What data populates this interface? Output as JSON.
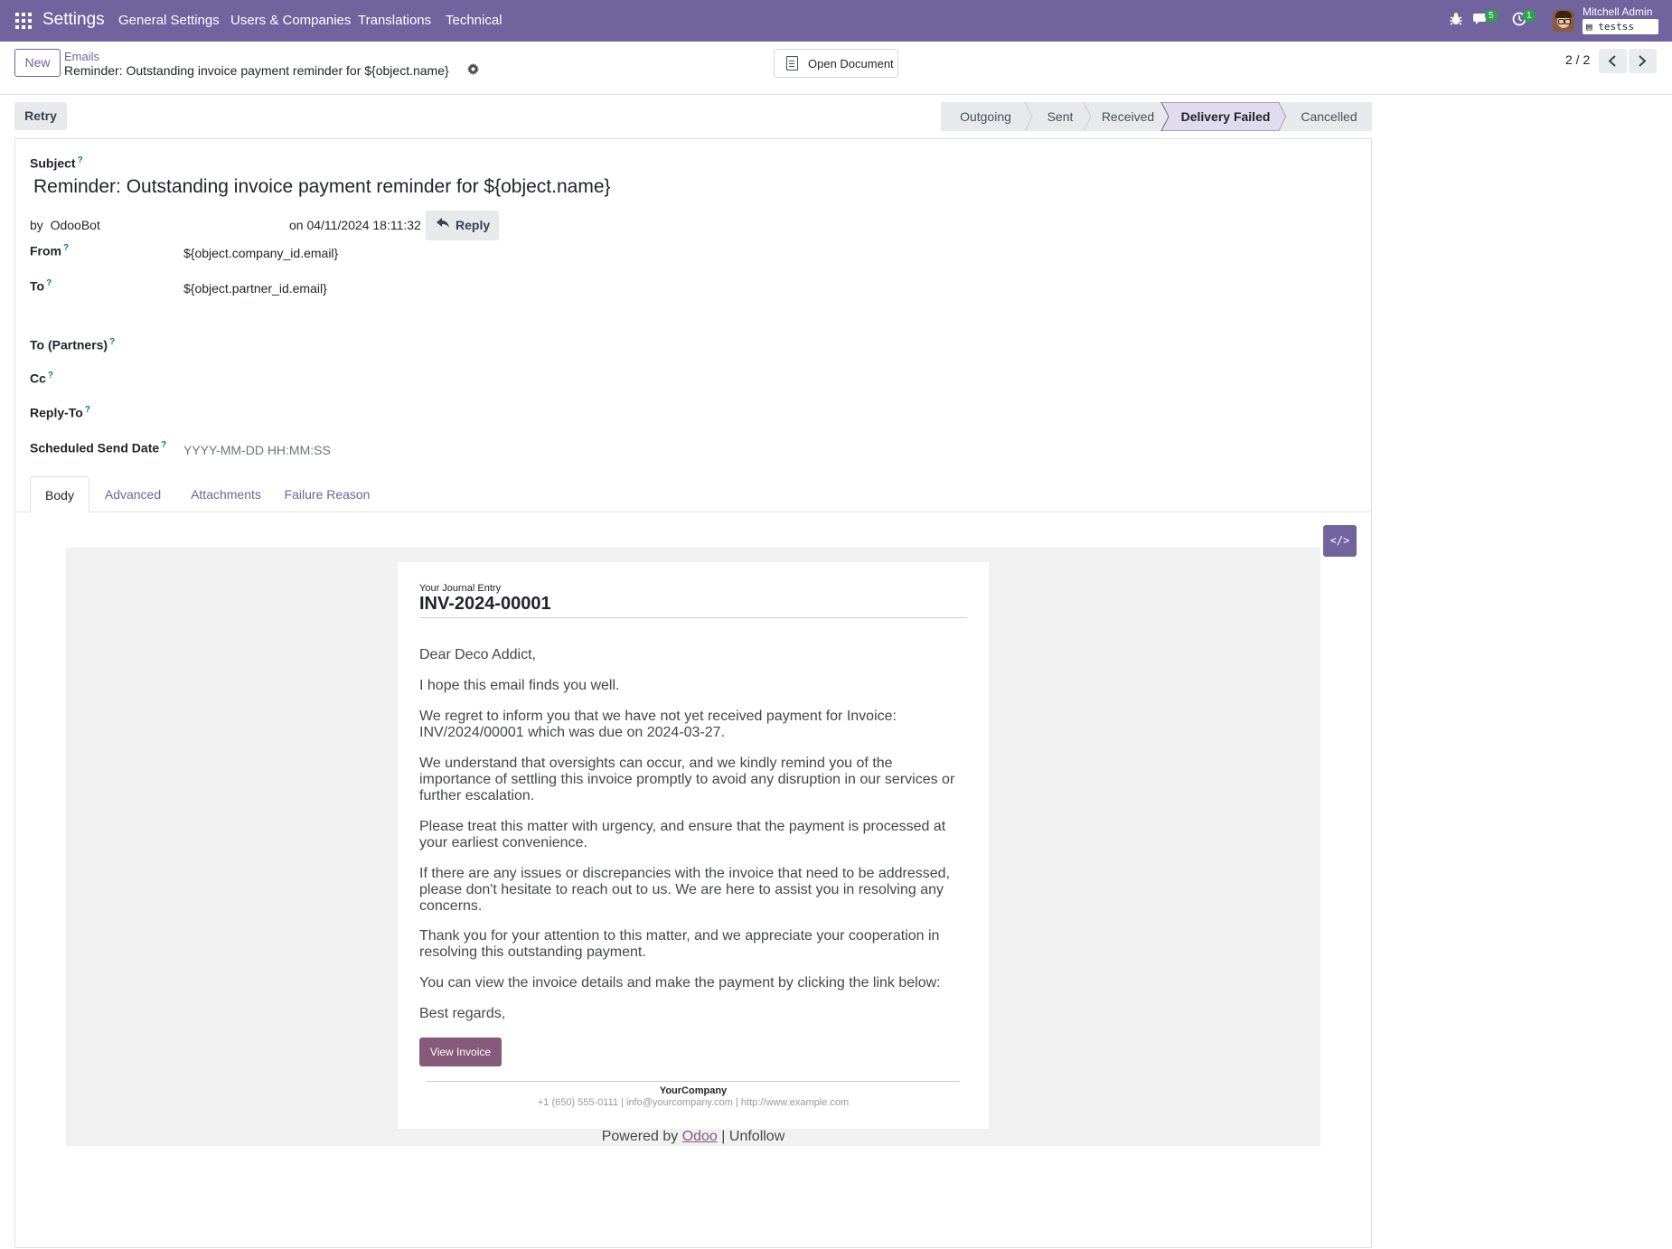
{
  "navbar": {
    "brand": "Settings",
    "menu": [
      "General Settings",
      "Users & Companies",
      "Translations",
      "Technical"
    ],
    "messages_count": "5",
    "activities_count": "1",
    "user_name": "Mitchell Admin",
    "database": "testss"
  },
  "control": {
    "new_label": "New",
    "breadcrumb_parent": "Emails",
    "breadcrumb_current": "Reminder: Outstanding invoice payment reminder for ${object.name}",
    "open_document_label": "Open Document",
    "pager": "2 / 2"
  },
  "statusbar": {
    "retry_label": "Retry",
    "stages": [
      "Outgoing",
      "Sent",
      "Received",
      "Delivery Failed",
      "Cancelled"
    ],
    "active_stage": "Delivery Failed"
  },
  "form": {
    "subject_label": "Subject",
    "subject_value": "Reminder: Outstanding invoice payment reminder for ${object.name}",
    "by_prefix": "by",
    "author": "OdooBot",
    "date_text": "on 04/11/2024 18:11:32",
    "reply_label": "Reply",
    "from_label": "From",
    "from_value": "${object.company_id.email}",
    "to_label": "To",
    "to_value": "${object.partner_id.email}",
    "to_partners_label": "To (Partners)",
    "cc_label": "Cc",
    "reply_to_label": "Reply-To",
    "scheduled_label": "Scheduled Send Date",
    "scheduled_placeholder": "YYYY-MM-DD HH:MM:SS",
    "help_mark": "?"
  },
  "tabs": [
    "Body",
    "Advanced",
    "Attachments",
    "Failure Reason"
  ],
  "active_tab": "Body",
  "email": {
    "header_small": "Your Journal Entry",
    "reference": "INV-2024-00001",
    "paragraphs": [
      "Dear Deco Addict,",
      "I hope this email finds you well.",
      "We regret to inform you that we have not yet received payment for Invoice: INV/2024/00001 which was due on 2024-03-27.",
      "We understand that oversights can occur, and we kindly remind you of the importance of settling this invoice promptly to avoid any disruption in our services or further escalation.",
      "Please treat this matter with urgency, and ensure that the payment is processed at your earliest convenience.",
      "If there are any issues or discrepancies with the invoice that need to be addressed, please don't hesitate to reach out to us. We are here to assist you in resolving any concerns.",
      "Thank you for your attention to this matter, and we appreciate your cooperation in resolving this outstanding payment.",
      "You can view the invoice details and make the payment by clicking the link below:",
      "Best regards,"
    ],
    "view_invoice_label": "View Invoice",
    "company": "YourCompany",
    "contact": "+1 (650) 555-0111 | info@yourcompany.com | http://www.example.com",
    "powered_prefix": "Powered by",
    "powered_link": "Odoo",
    "powered_separator": "|",
    "unfollow": "Unfollow"
  },
  "colors": {
    "navbar": "#71639e",
    "primary": "#71639e",
    "email_button": "#875a7b",
    "badge": "#28a745"
  },
  "icons": [
    "apps-grid-icon",
    "bug-icon",
    "chat-icon",
    "clock-icon",
    "document-icon",
    "gear-icon",
    "chevron-left-icon",
    "chevron-right-icon",
    "reply-icon",
    "code-icon"
  ]
}
